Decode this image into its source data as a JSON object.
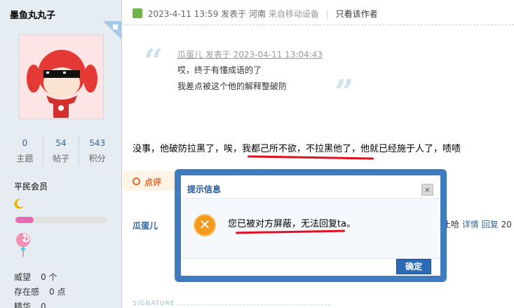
{
  "author": {
    "name": "墨鱼丸丸子",
    "stats": [
      {
        "value": "0",
        "label": "主题"
      },
      {
        "value": "54",
        "label": "帖子"
      },
      {
        "value": "543",
        "label": "积分"
      }
    ],
    "rank": "平民会员",
    "level_progress": 0.2,
    "profile": [
      {
        "label": "威望",
        "value": "0 个"
      },
      {
        "label": "存在感",
        "value": "0 点"
      },
      {
        "label": "精华",
        "value": "0"
      }
    ]
  },
  "post": {
    "date": "2023-4-11 13:59",
    "posted_label": "发表于",
    "location": "河南",
    "device": "来自移动设备",
    "only_author": "只看该作者",
    "quote": {
      "author_line": "瓜蛋儿 发表于 2023-04-11 13:04:43",
      "lines": [
        "哎，终于有懂成语的了",
        "我差点被这个他的解释整破防"
      ]
    },
    "content": "没事，他破防拉黑了，唉，我都己所不欲，不拉黑他了，他就已经施于人了，啧啧",
    "rate_label": "点评",
    "comment": {
      "user": "瓜蛋儿",
      "tail_text": "止哈",
      "detail_link": "详情",
      "reply_link": "回复",
      "time_fragment": "20"
    },
    "signature_label": "SIGNATURE"
  },
  "dialog": {
    "title": "提示信息",
    "close": "×",
    "icon_glyph": "✕",
    "message": "您已被对方屏蔽，无法回复ta。",
    "ok": "确定"
  },
  "colors": {
    "sidebar_bg": "#e5edf2",
    "link": "#336699",
    "dialog_border": "#3f7bbf",
    "annotation_red": "#e01020"
  }
}
